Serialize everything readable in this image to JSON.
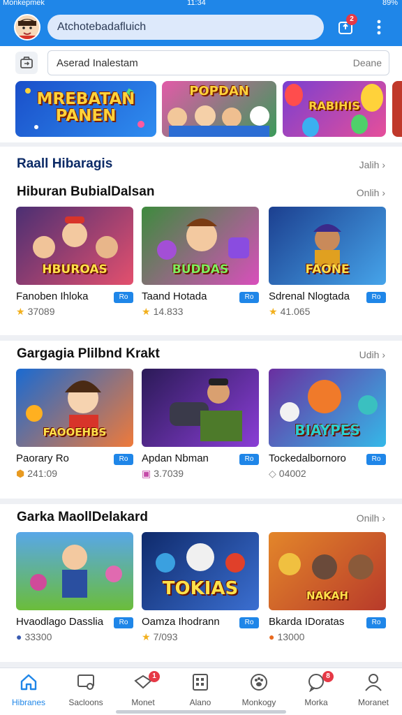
{
  "status_bar": {
    "carrier": "Monkepmek",
    "time": "11:34",
    "battery": "89%"
  },
  "header": {
    "search_text": "Atchotebadafluich",
    "notification_count": "2",
    "avatar_icon": "avatar-boy-icon",
    "inbox_icon": "inbox-upload-icon",
    "menu_icon": "kebab-menu-icon"
  },
  "search": {
    "scan_icon": "scan-icon",
    "value": "Aserad Inalestam",
    "clear_label": "Deane"
  },
  "banners": [
    {
      "title": "MREBATAN PANEN"
    },
    {
      "title": "POPDAN"
    },
    {
      "title": "RABIHIS"
    }
  ],
  "section_header": {
    "title": "Raall Hibaragis",
    "more": "Jalih ›"
  },
  "sections": [
    {
      "title": "Hiburan BubialDalsan",
      "more": "Onlih ›",
      "games": [
        {
          "name": "Fanoben Ihloka",
          "tag": "Ro",
          "rating": "37089",
          "caption": "HBUROAS",
          "bg": [
            "#4b2f73",
            "#e3506e"
          ]
        },
        {
          "name": "Taand Hotada",
          "tag": "Ro",
          "rating": "14.833",
          "caption": "BUDDAS",
          "bg": [
            "#3d8b3d",
            "#d94fbc"
          ]
        },
        {
          "name": "Sdrenal Nlogtada",
          "tag": "Ro",
          "rating": "41.065",
          "caption": "FAONE",
          "bg": [
            "#1c3f8f",
            "#46a4ea"
          ]
        }
      ]
    },
    {
      "title": "Gargagia Plilbnd Krakt",
      "more": "Udih ›",
      "games": [
        {
          "name": "Paorary Ro",
          "tag": "Ro",
          "rating": "241:09",
          "caption": "FAOOEHBS",
          "bg": [
            "#1a6ad1",
            "#ef7a3a"
          ]
        },
        {
          "name": "Apdan Nbman",
          "tag": "Ro",
          "rating": "3.7039",
          "caption": "",
          "bg": [
            "#2b1a57",
            "#8a3ed6"
          ]
        },
        {
          "name": "Tockedalbornoro",
          "tag": "Ro",
          "rating": "04002",
          "caption": "BIAYPES",
          "bg": [
            "#6a2fa0",
            "#35b8e8"
          ]
        }
      ]
    },
    {
      "title": "Garka MaollDelakard",
      "more": "Onilh ›",
      "games": [
        {
          "name": "Hvaodlago Dasslia",
          "tag": "Ro",
          "rating": "33300",
          "caption": "",
          "bg": [
            "#58a7e8",
            "#6bbd3a"
          ]
        },
        {
          "name": "Oamza Ihodrann",
          "tag": "Ro",
          "rating": "7/093",
          "caption": "TOKIAS",
          "bg": [
            "#0f2a6b",
            "#3b6fd1"
          ]
        },
        {
          "name": "Bkarda IDoratas",
          "tag": "Ro",
          "rating": "13000",
          "caption": "NAKAH",
          "bg": [
            "#e3862a",
            "#b83a2a"
          ]
        }
      ]
    }
  ],
  "bottom_nav": [
    {
      "label": "Hibranes",
      "icon": "home-icon",
      "badge": ""
    },
    {
      "label": "Sacloons",
      "icon": "screen-icon",
      "badge": ""
    },
    {
      "label": "Monet",
      "icon": "ticket-icon",
      "badge": "1"
    },
    {
      "label": "Alano",
      "icon": "calendar-grid-icon",
      "badge": ""
    },
    {
      "label": "Monkogy",
      "icon": "paw-icon",
      "badge": ""
    },
    {
      "label": "Morka",
      "icon": "chat-bubble-icon",
      "badge": "8"
    },
    {
      "label": "Moranet",
      "icon": "profile-icon",
      "badge": ""
    }
  ],
  "colors": {
    "brand": "#1f86e8",
    "accent_badge": "#e63946",
    "star": "#f2b01e"
  }
}
